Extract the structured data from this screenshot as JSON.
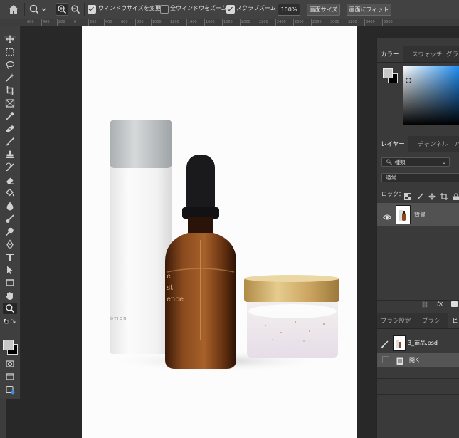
{
  "options_bar": {
    "resize_windows_label": "ウィンドウサイズを変更",
    "all_windows_label": "全ウィンドウをズーム",
    "scrubby_zoom_label": "スクラブズーム",
    "zoom_percent": "100%",
    "fit_screen_label": "画面サイズ",
    "fill_screen_label": "画面にフィット",
    "resize_windows_checked": true,
    "all_windows_checked": false,
    "scrubby_zoom_checked": true
  },
  "ruler": {
    "ticks": [
      "600",
      "400",
      "200",
      "0",
      "200",
      "400",
      "600",
      "800",
      "1000",
      "1200",
      "1400",
      "1600",
      "1800",
      "2000",
      "2200",
      "2400",
      "2600",
      "2800",
      "3000",
      "3200",
      "3400",
      "3600"
    ]
  },
  "color_panel": {
    "tabs": [
      "カラー",
      "スウォッチ",
      "グラ"
    ],
    "active_tab": 0
  },
  "layers_panel": {
    "tabs": [
      "レイヤー",
      "チャンネル",
      "パ"
    ],
    "filter_kind": "種類",
    "blend_mode": "通常",
    "lock_label": "ロック：",
    "layers": [
      {
        "name": "背景",
        "visible": true,
        "selected": true
      }
    ]
  },
  "history_panel": {
    "tabs": [
      "ブラシ設定",
      "ブラシ",
      "ヒ"
    ],
    "document_name": "3_商品.psd",
    "items": [
      {
        "label": "開く"
      }
    ]
  },
  "colors": {
    "foreground": "#c8c8c8",
    "background": "#000000",
    "accent_blue": "#1e8cf0"
  },
  "product_photo": {
    "bottle_label_lines": [
      "e",
      "st",
      "ence"
    ],
    "lotion_label": "OTION"
  }
}
